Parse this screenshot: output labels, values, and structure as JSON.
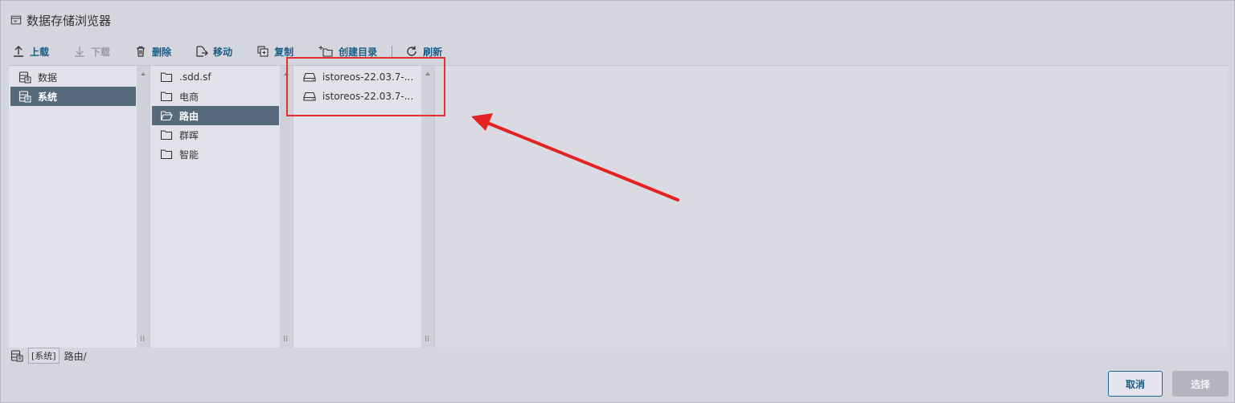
{
  "window": {
    "title": "数据存储浏览器",
    "icon": "browser-icon"
  },
  "toolbar": {
    "upload": "上载",
    "download": "下载",
    "delete": "删除",
    "move": "移动",
    "copy": "复制",
    "create_dir": "创建目录",
    "refresh": "刷新"
  },
  "columns": {
    "datastores": [
      {
        "label": "数据",
        "icon": "datastore-icon",
        "selected": false
      },
      {
        "label": "系统",
        "icon": "datastore-icon",
        "selected": true
      }
    ],
    "folders": [
      {
        "label": ".sdd.sf",
        "icon": "folder-icon",
        "selected": false
      },
      {
        "label": "电商",
        "icon": "folder-icon",
        "selected": false
      },
      {
        "label": "路由",
        "icon": "folder-open-icon",
        "selected": true
      },
      {
        "label": "群晖",
        "icon": "folder-icon",
        "selected": false
      },
      {
        "label": "智能",
        "icon": "folder-icon",
        "selected": false
      }
    ],
    "files": [
      {
        "label": "istoreos-22.03.7-...",
        "icon": "disk-icon"
      },
      {
        "label": "istoreos-22.03.7-...",
        "icon": "disk-icon"
      }
    ]
  },
  "status": {
    "datastore": "[系统]",
    "path": "路由/"
  },
  "buttons": {
    "cancel": "取消",
    "select": "选择"
  },
  "colors": {
    "accent": "#1a5d86",
    "selection": "#566a7c",
    "annotation": "#e03030"
  }
}
